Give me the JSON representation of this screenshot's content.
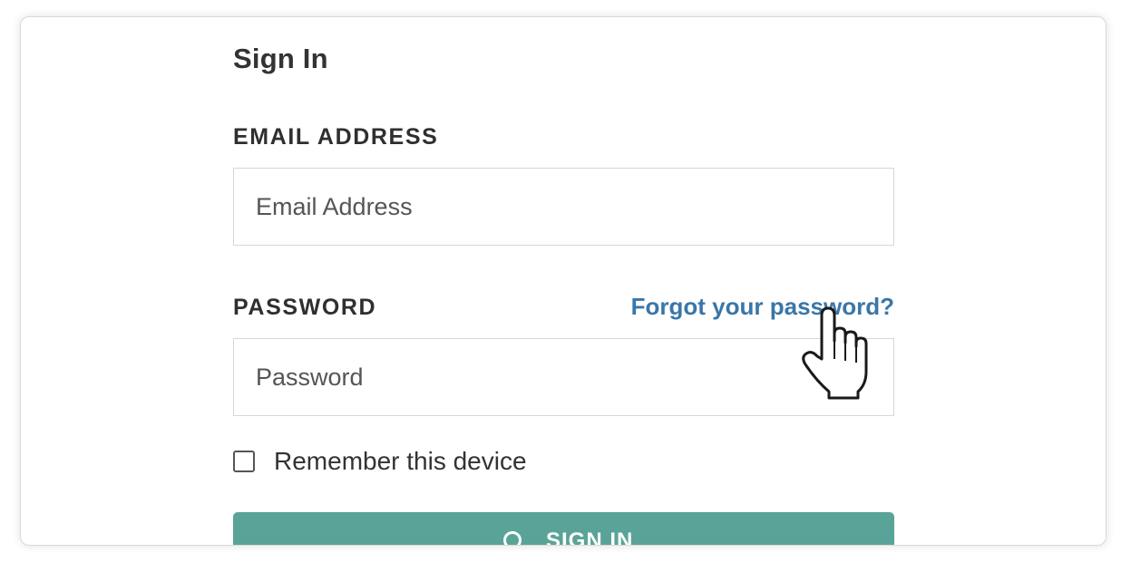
{
  "signin": {
    "title": "Sign In",
    "email_label": "EMAIL ADDRESS",
    "email_placeholder": "Email Address",
    "email_value": "",
    "password_label": "PASSWORD",
    "password_placeholder": "Password",
    "password_value": "",
    "forgot_link": "Forgot your password?",
    "remember_label": "Remember this device",
    "remember_checked": false,
    "submit_label": "SIGN IN",
    "submit_icon": "lock-icon"
  },
  "cursor": {
    "icon": "hand-pointer-icon"
  },
  "colors": {
    "link": "#3a76a8",
    "button": "#5aa398",
    "text": "#333333"
  }
}
